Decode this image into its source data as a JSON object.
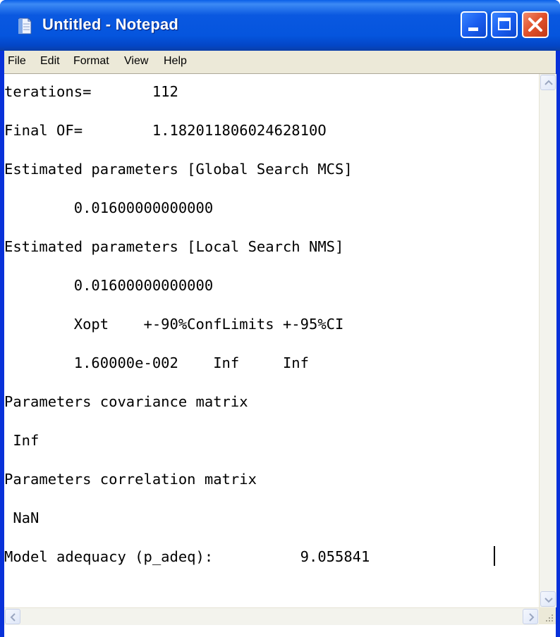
{
  "window": {
    "title": "Untitled - Notepad"
  },
  "menu": {
    "items": [
      "File",
      "Edit",
      "Format",
      "View",
      "Help"
    ]
  },
  "editor": {
    "lines": [
      "terations=       112",
      "Final OF=        1.18201180602462810О",
      "Estimated parameters [Global Search MCS]",
      "        0.01600000000000",
      "Estimated parameters [Local Search NMS]",
      "        0.01600000000000",
      "        Xopt    +-90%ConfLimits +-95%CI",
      "        1.60000e-002    Inf     Inf",
      "Parameters covariance matrix",
      " Inf",
      "Parameters correlation matrix",
      " NaN",
      "Model adequacy (p_adeq):          9.055841"
    ]
  },
  "icons": {
    "app": "notepad-icon",
    "minimize": "minimize-icon",
    "maximize": "maximize-icon",
    "close": "close-icon",
    "scroll_up": "arrow-up-icon",
    "scroll_down": "arrow-down-icon",
    "scroll_left": "arrow-left-icon",
    "scroll_right": "arrow-right-icon",
    "grip": "resize-grip-icon"
  },
  "colors": {
    "titlebar": "#0a58e0",
    "close": "#e0502a",
    "menubar": "#ece9d8"
  }
}
